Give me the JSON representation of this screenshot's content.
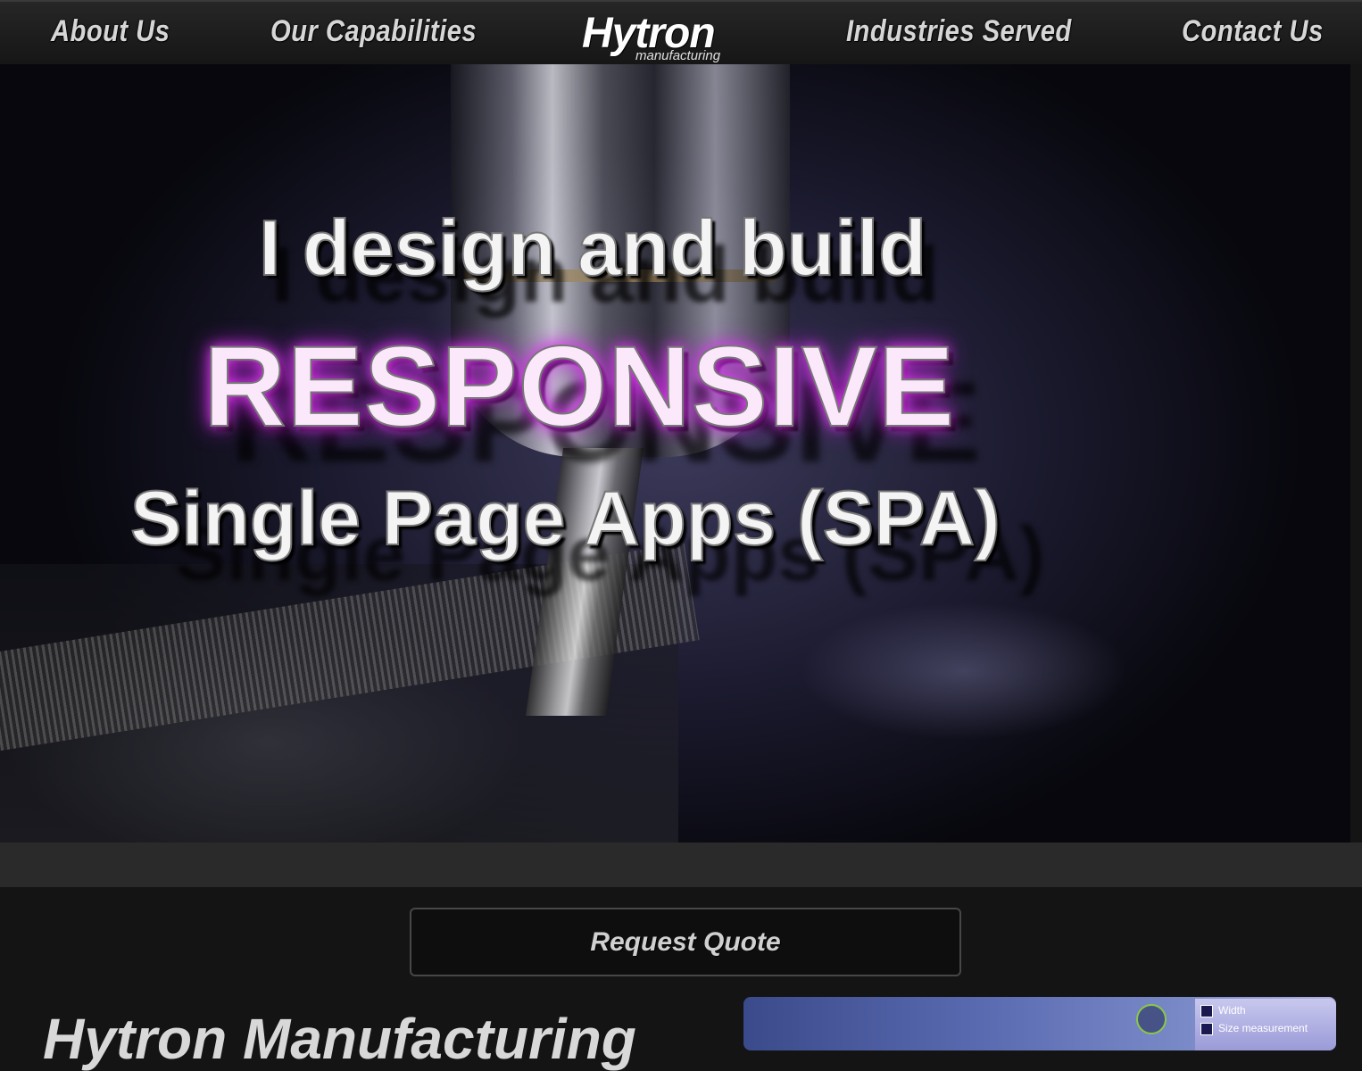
{
  "nav": {
    "items": [
      {
        "label": "About Us"
      },
      {
        "label": "Our Capabilities"
      },
      {
        "label": "Industries Served"
      },
      {
        "label": "Contact Us"
      }
    ],
    "logo": {
      "name": "Hytron",
      "tagline": "manufacturing"
    }
  },
  "hero": {
    "line1": "I design and build",
    "line2": "RESPONSIVE",
    "line3": "Single Page Apps (SPA)",
    "accent_color": "#e040f0"
  },
  "cta": {
    "label": "Request Quote"
  },
  "section": {
    "heading": "Hytron Manufacturing"
  },
  "side_image": {
    "rows": [
      "Width",
      "Size measurement"
    ]
  }
}
